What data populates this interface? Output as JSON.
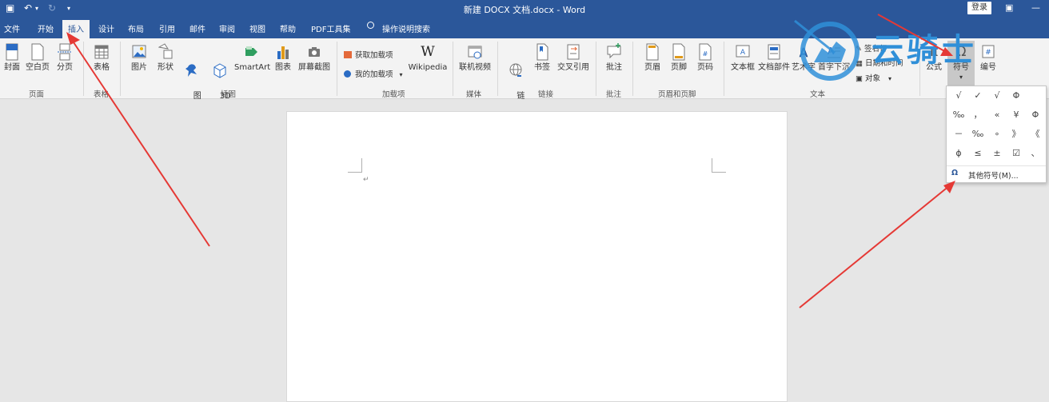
{
  "window": {
    "title": "新建 DOCX 文档.docx  -  Word",
    "login_label": "登录"
  },
  "tabs": [
    {
      "label": "文件"
    },
    {
      "label": "开始"
    },
    {
      "label": "插入"
    },
    {
      "label": "设计"
    },
    {
      "label": "布局"
    },
    {
      "label": "引用"
    },
    {
      "label": "邮件"
    },
    {
      "label": "审阅"
    },
    {
      "label": "视图"
    },
    {
      "label": "帮助"
    },
    {
      "label": "PDF工具集"
    },
    {
      "label": "操作说明搜索"
    }
  ],
  "ribbon": {
    "pages": {
      "cover": "封面",
      "blank": "空白页",
      "break": "分页",
      "group": "页面"
    },
    "tables": {
      "table": "表格",
      "group": "表格"
    },
    "illustrations": {
      "pictures": "图片",
      "shapes": "形状",
      "icons": "图\n标",
      "model3d": "3D\n模型",
      "smartart": "SmartArt",
      "chart": "图表",
      "screenshot": "屏幕截图",
      "group": "插图"
    },
    "addins": {
      "get": "获取加载项",
      "my": "我的加载项",
      "wikipedia": "Wikipedia",
      "group": "加载项"
    },
    "media": {
      "video": "联机视频",
      "group": "媒体"
    },
    "links": {
      "link": "链\n接",
      "bookmark": "书签",
      "crossref": "交叉引用",
      "group": "链接"
    },
    "comments": {
      "comment": "批注",
      "group": "批注"
    },
    "header_footer": {
      "header": "页眉",
      "footer": "页脚",
      "page_number": "页码",
      "group": "页眉和页脚"
    },
    "text": {
      "textbox": "文本框",
      "quickparts": "文档部件",
      "wordart": "艺术字",
      "dropcap": "首字下沉",
      "signature": "签名行",
      "datetime": "日期和时间",
      "object": "对象",
      "group": "文本"
    },
    "symbols": {
      "equation": "公式",
      "symbol": "符号",
      "number": "编号"
    }
  },
  "symbol_menu": {
    "symbols": [
      [
        "√",
        "✓",
        "√",
        "Φ"
      ],
      [
        "‰",
        "，",
        "«",
        "¥",
        "Φ"
      ],
      [
        "－",
        "‰",
        "∘",
        "》",
        "《"
      ],
      [
        "ϕ",
        "≤",
        "±",
        "☑",
        "、"
      ]
    ],
    "more_label": "其他符号(M)...",
    "more_icon": "Ω"
  },
  "watermark": {
    "text": "云骑士"
  },
  "colors": {
    "accent": "#2b579a",
    "arrow": "#e53935",
    "watermark": "#2f8fd8"
  }
}
